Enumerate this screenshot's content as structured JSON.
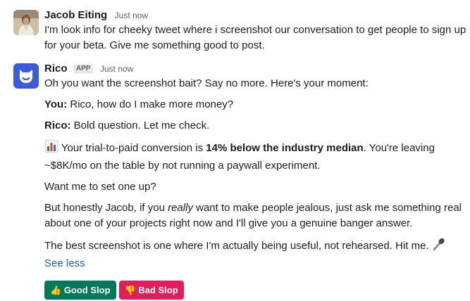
{
  "messages": [
    {
      "author": "Jacob Eiting",
      "timestamp": "Just now",
      "text": "I'm look info for cheeky tweet where i screenshot our conversation to get people to sign up for your beta. Give me something good to post."
    },
    {
      "author": "Rico",
      "badge": "APP",
      "timestamp": "Just now",
      "intro": "Oh you want the screenshot bait? Say no more. Here's your moment:",
      "you_label": "You:",
      "you_text": " Rico, how do I make more money?",
      "rico_label": "Rico:",
      "rico_text": " Bold question. Let me check.",
      "stat_icon": "bar-chart-icon",
      "stat_pre": " Your trial-to-paid conversion is ",
      "stat_bold": "14% below the industry median",
      "stat_post": ". You're leaving ~$8K/mo on the table by not running a paywall experiment.",
      "question": "Want me to set one up?",
      "p5_pre": "But honestly Jacob, if you ",
      "p5_em": "really",
      "p5_post": " want to make people jealous, just ask me something real about one of your projects right now and I'll give you a genuine banger answer.",
      "p6": "The best screenshot is one where I'm actually being useful, not rehearsed. Hit me. ",
      "p6_icon": "microphone-icon",
      "see_less": "See less"
    }
  ],
  "actions": {
    "good_label": "Good Slop",
    "good_icon": "thumbs-up-icon",
    "bad_label": "Bad Slop",
    "bad_icon": "thumbs-down-icon"
  },
  "colors": {
    "rico_avatar_bg": "#3b5bdb",
    "good_button": "#007a5a",
    "bad_button": "#e01e5a",
    "link": "#1264a3"
  }
}
